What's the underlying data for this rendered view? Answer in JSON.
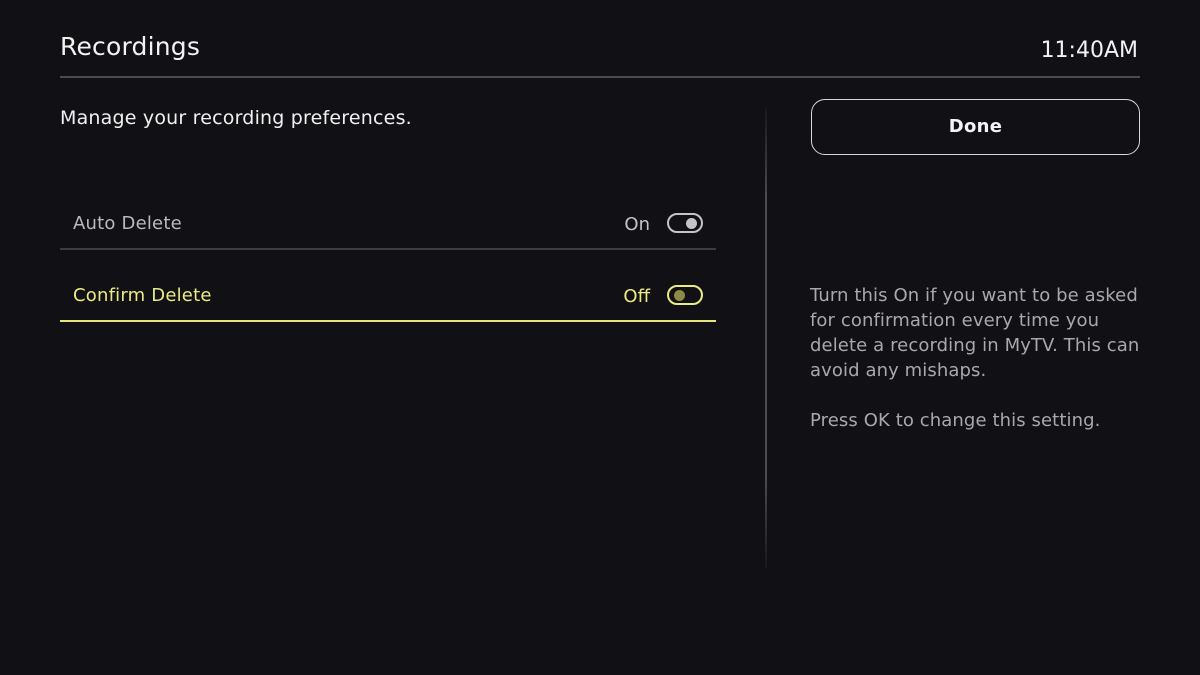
{
  "header": {
    "title": "Recordings",
    "clock": "11:40AM"
  },
  "subtitle": "Manage your recording preferences.",
  "settings": [
    {
      "label": "Auto Delete",
      "state": "On",
      "enabled": true,
      "focused": false
    },
    {
      "label": "Confirm Delete",
      "state": "Off",
      "enabled": false,
      "focused": true
    }
  ],
  "done_label": "Done",
  "help": {
    "description": "Turn this On if you want to be asked for confirmation every time you delete a recording in MyTV. This can avoid any mishaps.",
    "hint": "Press OK to change this setting."
  },
  "colors": {
    "background": "#111015",
    "focus_accent": "#ecea82",
    "text_primary": "#f2f2f2",
    "text_secondary": "#a8a8ad"
  }
}
